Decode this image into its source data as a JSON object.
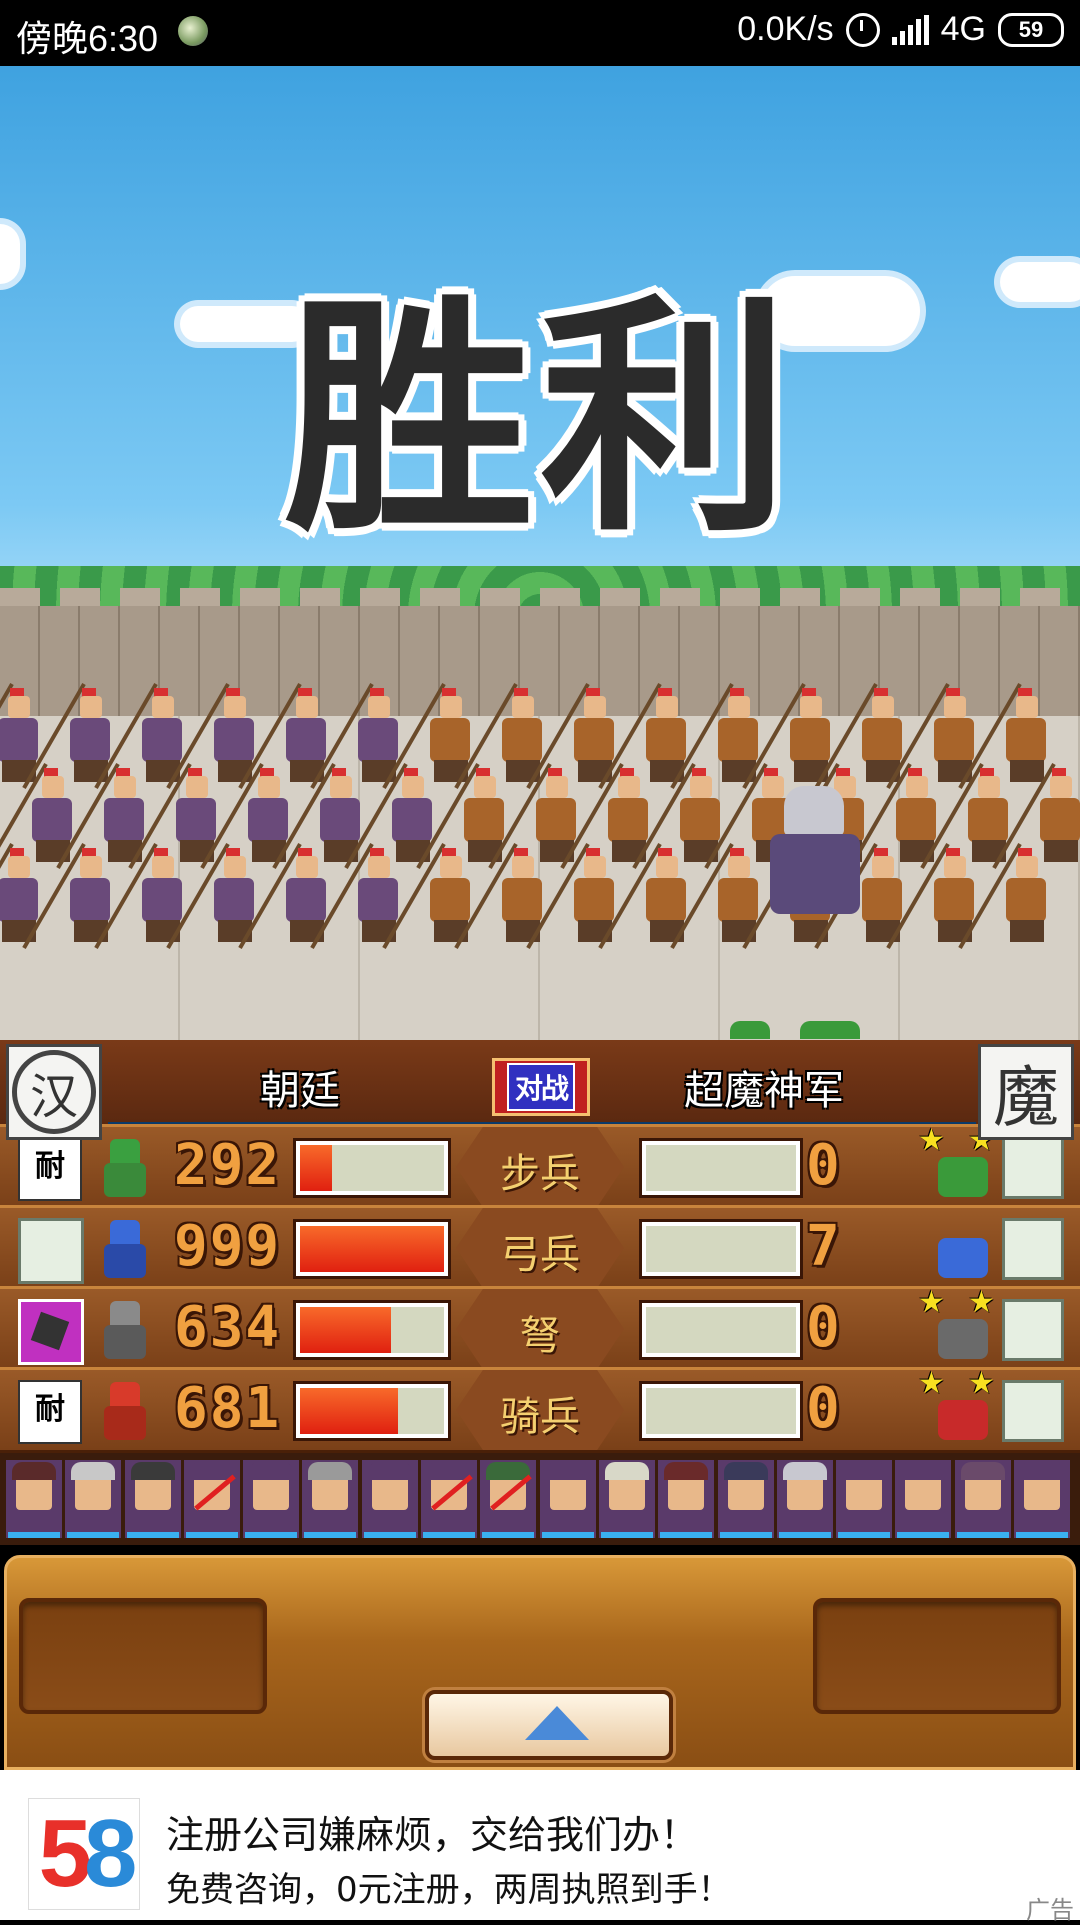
{
  "status_bar": {
    "time": "傍晚6:30",
    "network_speed": "0.0K/s",
    "network_type": "4G",
    "battery": "59"
  },
  "scene": {
    "banner": "胜利"
  },
  "battle": {
    "left_army": "朝廷",
    "right_army": "超魔神军",
    "vs_label": "对战",
    "left_emblem": "汉",
    "right_emblem": "魔",
    "rows": [
      {
        "type": "步兵",
        "ally_count": "292",
        "ally_fill": 0.22,
        "enemy_count": "0",
        "enemy_fill": 0.0
      },
      {
        "type": "弓兵",
        "ally_count": "999",
        "ally_fill": 1.0,
        "enemy_count": "7",
        "enemy_fill": 0.0
      },
      {
        "type": "弩",
        "ally_count": "634",
        "ally_fill": 0.63,
        "enemy_count": "0",
        "enemy_fill": 0.0
      },
      {
        "type": "骑兵",
        "ally_count": "681",
        "ally_fill": 0.68,
        "enemy_count": "0",
        "enemy_fill": 0.0
      }
    ],
    "wall_icon_text": "耐"
  },
  "ad": {
    "logo": "58",
    "line1": "注册公司嫌麻烦，交给我们办！",
    "line2": "免费咨询，0元注册，两周执照到手！",
    "tag": "广告"
  }
}
